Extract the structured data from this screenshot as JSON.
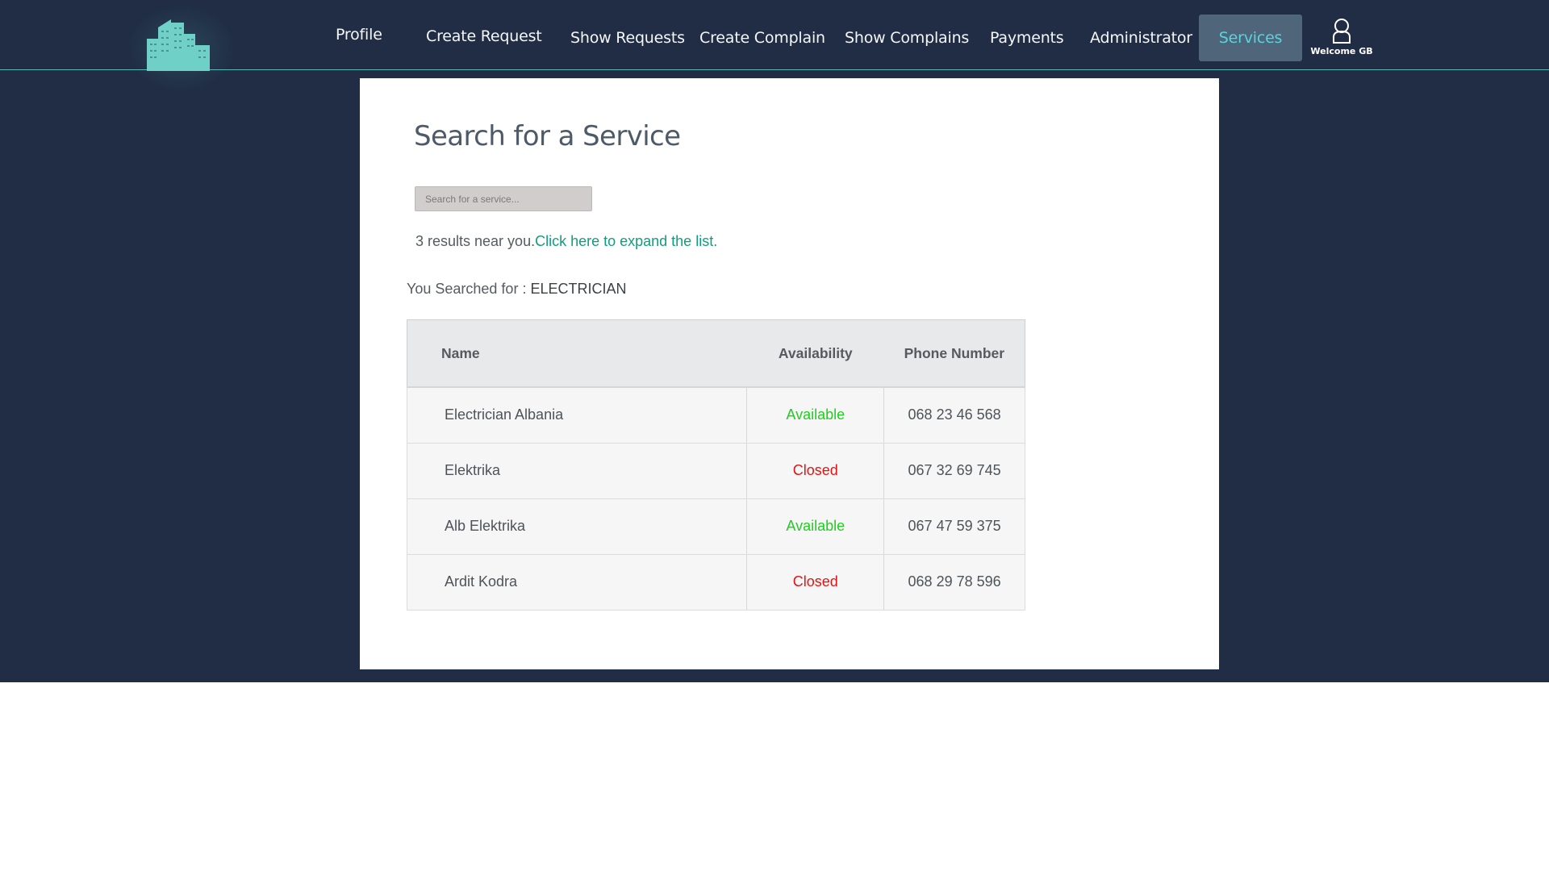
{
  "nav": {
    "items": [
      {
        "label": "Profile",
        "active": false
      },
      {
        "label": "Create Request",
        "active": false
      },
      {
        "label": "Show Requests",
        "active": false
      },
      {
        "label": "Create Complain",
        "active": false
      },
      {
        "label": "Show Complains",
        "active": false
      },
      {
        "label": "Payments",
        "active": false
      },
      {
        "label": "Administrator",
        "active": false
      },
      {
        "label": "Services",
        "active": true
      }
    ],
    "user": {
      "icon": "user-icon",
      "welcome": "Welcome GB"
    },
    "logo_icon": "buildings-logo-icon"
  },
  "main": {
    "title": "Search for a Service",
    "search": {
      "placeholder": "Search for a service...",
      "value": ""
    },
    "results_text": "3 results near you.",
    "expand_link": "Click here to expand the list.",
    "searched_label": "You Searched for : ",
    "searched_term": "ELECTRICIAN"
  },
  "table": {
    "headers": {
      "name": "Name",
      "availability": "Availability",
      "phone": "Phone Number"
    },
    "rows": [
      {
        "name": "Electrician Albania",
        "availability": "Available",
        "phone": "068 23 46 568"
      },
      {
        "name": "Elektrika",
        "availability": "Closed",
        "phone": "067 32 69 745"
      },
      {
        "name": "Alb Elektrika",
        "availability": "Available",
        "phone": "067 47 59 375"
      },
      {
        "name": "Ardit Kodra",
        "availability": "Closed",
        "phone": "068 29 78 596"
      }
    ]
  },
  "colors": {
    "background": "#202d44",
    "accent": "#59d4dc",
    "link": "#0e9e7e",
    "available": "#22cc22",
    "closed": "#e01414",
    "active_tab_bg": "#4f6579"
  }
}
